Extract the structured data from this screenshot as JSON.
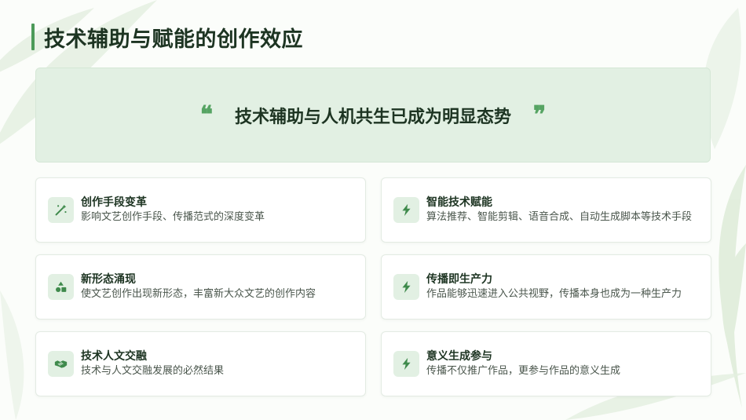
{
  "slide": {
    "title": "技术辅助与赋能的创作效应",
    "quote": {
      "open_mark": "❝",
      "text": "技术辅助与人机共生已成为明显态势",
      "close_mark": "❞"
    }
  },
  "cards": [
    {
      "icon": "magic-wand-icon",
      "title": "创作手段变革",
      "desc": "影响文艺创作手段、传播范式的深度变革"
    },
    {
      "icon": "lightning-icon",
      "title": "智能技术赋能",
      "desc": "算法推荐、智能剪辑、语音合成、自动生成脚本等技术手段"
    },
    {
      "icon": "shapes-icon",
      "title": "新形态涌现",
      "desc": "使文艺创作出现新形态，丰富新大众文艺的创作内容"
    },
    {
      "icon": "lightning-icon",
      "title": "传播即生产力",
      "desc": "作品能够迅速进入公共视野，传播本身也成为一种生产力"
    },
    {
      "icon": "handshake-icon",
      "title": "技术人文交融",
      "desc": "技术与人文交融发展的必然结果"
    },
    {
      "icon": "lightning-icon",
      "title": "意义生成参与",
      "desc": "传播不仅推广作品，更参与作品的意义生成"
    }
  ],
  "colors": {
    "accent": "#4c9a59",
    "quote_bg": "#e2f0e3",
    "title_text": "#1d3422"
  }
}
